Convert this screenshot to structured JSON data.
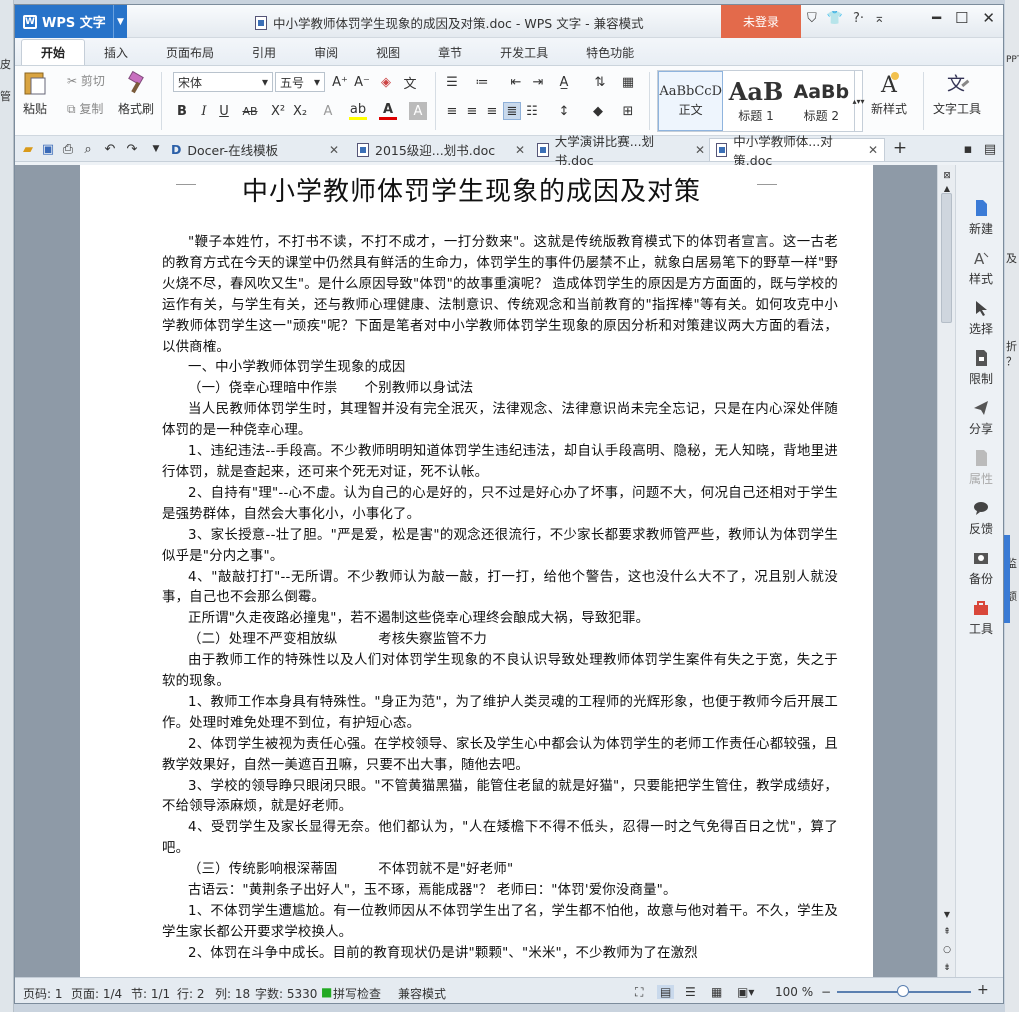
{
  "app": {
    "name": "WPS 文字",
    "title": "中小学教师体罚学生现象的成因及对策.doc - WPS 文字 - 兼容模式",
    "login": "未登录"
  },
  "menu_tabs": [
    "开始",
    "插入",
    "页面布局",
    "引用",
    "审阅",
    "视图",
    "章节",
    "开发工具",
    "特色功能"
  ],
  "toolbar": {
    "paste": "粘贴",
    "cut": "剪切",
    "copy": "复制",
    "format_painter": "格式刷",
    "font": "宋体",
    "size": "五号",
    "styles": [
      {
        "preview": "AaBbCcD",
        "name": "正文"
      },
      {
        "preview": "AaB",
        "name": "标题 1"
      },
      {
        "preview": "AaBb",
        "name": "标题 2"
      }
    ],
    "new_style": "新样式",
    "text_tools": "文字工具"
  },
  "doc_tabs": [
    {
      "label": "Docer-在线模板"
    },
    {
      "label": "2015级迎...划书.doc"
    },
    {
      "label": "大学演讲比赛...划书.doc"
    },
    {
      "label": "中小学教师体...对策.doc"
    }
  ],
  "document": {
    "title": "中小学教师体罚学生现象的成因及对策",
    "paragraphs": [
      "\"鞭子本姓竹，不打书不读，不打不成才，一打分数来\"。这就是传统版教育模式下的体罚者宣言。这一古老的教育方式在今天的课堂中仍然具有鲜活的生命力，体罚学生的事件仍屡禁不止，就象白居易笔下的野草一样\"野火烧不尽，春风吹又生\"。是什么原因导致\"体罚\"的故事重演呢？ 造成体罚学生的原因是方方面面的，既与学校的运作有关，与学生有关，还与教师心理健康、法制意识、传统观念和当前教育的\"指挥棒\"等有关。如何攻克中小学教师体罚学生这一\"顽疾\"呢？下面是笔者对中小学教师体罚学生现象的原因分析和对策建议两大方面的看法，以供商榷。",
      "一、中小学教师体罚学生现象的成因",
      "（一）侥幸心理暗中作祟　　个别教师以身试法",
      "当人民教师体罚学生时，其理智并没有完全泯灭，法律观念、法律意识尚未完全忘记，只是在内心深处伴随体罚的是一种侥幸心理。",
      "1、违纪违法--手段高。不少教师明明知道体罚学生违纪违法，却自认手段高明、隐秘，无人知晓，背地里进行体罚，就是查起来，还可来个死无对证，死不认帐。",
      "2、自持有\"理\"--心不虚。认为自己的心是好的，只不过是好心办了坏事，问题不大，何况自己还相对于学生是强势群体，自然会大事化小，小事化了。",
      "3、家长授意--壮了胆。\"严是爱，松是害\"的观念还很流行，不少家长都要求教师管严些，教师认为体罚学生似乎是\"分内之事\"。",
      "4、\"敲敲打打\"--无所谓。不少教师认为敲一敲，打一打，给他个警告，这也没什么大不了，况且别人就没事，自己也不会那么倒霉。",
      "正所谓\"久走夜路必撞鬼\"，若不遏制这些侥幸心理终会酿成大祸，导致犯罪。",
      "（二）处理不严变相放纵　　　考核失察监管不力",
      "由于教师工作的特殊性以及人们对体罚学生现象的不良认识导致处理教师体罚学生案件有失之于宽，失之于软的现象。",
      "1、教师工作本身具有特殊性。\"身正为范\"，为了维护人类灵魂的工程师的光辉形象，也便于教师今后开展工作。处理时难免处理不到位，有护短心态。",
      "2、体罚学生被视为责任心强。在学校领导、家长及学生心中都会认为体罚学生的老师工作责任心都较强，且教学效果好，自然一美遮百丑嘛，只要不出大事，随他去吧。",
      "3、学校的领导睁只眼闭只眼。\"不管黄猫黑猫，能管住老鼠的就是好猫\"，只要能把学生管住，教学成绩好，不给领导添麻烦，就是好老师。",
      "4、受罚学生及家长显得无奈。他们都认为，\"人在矮檐下不得不低头，忍得一时之气免得百日之忧\"，算了吧。",
      "（三）传统影响根深蒂固　　　不体罚就不是\"好老师\"",
      "古语云：\"黄荆条子出好人\"，玉不琢，焉能成器\"？ 老师曰：\"体罚'爱你没商量\"。",
      "1、不体罚学生遭尴尬。有一位教师因从不体罚学生出了名，学生都不怕他，故意与他对着干。不久，学生及学生家长都公开要求学校换人。",
      "2、体罚在斗争中成长。目前的教育现状仍是讲\"颗颗\"、\"米米\"，不少教师为了在激烈"
    ]
  },
  "side_panel": [
    "新建",
    "样式",
    "选择",
    "限制",
    "分享",
    "属性",
    "反馈",
    "备份",
    "工具"
  ],
  "status": {
    "page": "页码: 1",
    "pages": "页面: 1/4",
    "section": "节: 1/1",
    "row": "行: 2",
    "col": "列: 18",
    "words": "字数: 5330",
    "spell": "拼写检查",
    "mode": "兼容模式",
    "zoom": "100 %"
  },
  "background_text": {
    "left": [
      "皮",
      "管"
    ],
    "right": [
      "页",
      "及",
      "折",
      "？",
      "监",
      "额",
      "PPT"
    ]
  }
}
